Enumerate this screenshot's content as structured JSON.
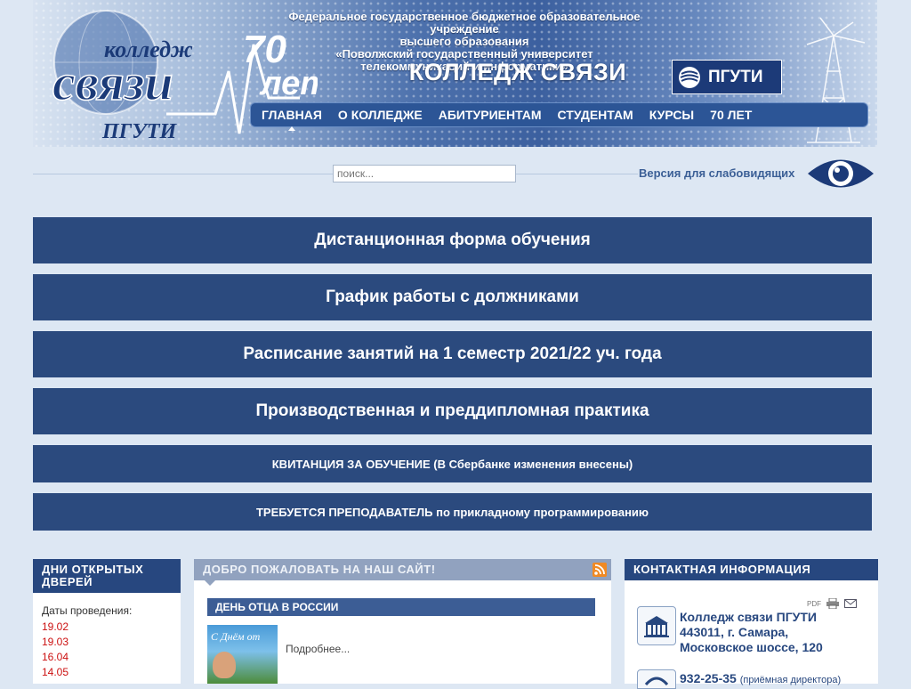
{
  "header": {
    "logo_text_top": "колледж",
    "logo_text_main": "связи",
    "logo_text_bottom": "ПГУТИ",
    "anniversary_number": "70",
    "anniversary_word": "лет",
    "institution_lines": [
      "Федеральное государственное бюджетное образовательное учреждение",
      "высшего образования",
      "«Поволжский государственный университет",
      "телекоммуникаций и информатики»"
    ],
    "title": "КОЛЛЕДЖ СВЯЗИ",
    "badge_label": "ПГУТИ"
  },
  "nav": {
    "items": [
      {
        "label": "ГЛАВНАЯ",
        "active": true
      },
      {
        "label": "О КОЛЛЕДЖЕ"
      },
      {
        "label": "АБИТУРИЕНТАМ"
      },
      {
        "label": "СТУДЕНТАМ"
      },
      {
        "label": "КУРСЫ"
      },
      {
        "label": "70 ЛЕТ"
      }
    ]
  },
  "search": {
    "placeholder": "поиск..."
  },
  "accessibility": {
    "label": "Версия для слабовидящих",
    "icon": "eye-icon"
  },
  "bands": [
    {
      "label": "Дистанционная форма обучения"
    },
    {
      "label": "График работы с должниками"
    },
    {
      "label": "Расписание занятий на 1 семестр 2021/22 уч. года"
    },
    {
      "label": "Производственная и преддипломная практика"
    },
    {
      "label": "КВИТАНЦИЯ ЗА ОБУЧЕНИЕ (В Сбербанке изменения внесены)"
    },
    {
      "label": "ТРЕБУЕТСЯ ПРЕПОДАВАТЕЛЬ по прикладному программированию"
    }
  ],
  "open_days": {
    "title": "ДНИ ОТКРЫТЫХ ДВЕРЕЙ",
    "subtitle": "Даты проведения:",
    "dates": [
      "19.02",
      "19.03",
      "16.04",
      "14.05"
    ]
  },
  "welcome": {
    "title": "ДОБРО ПОЖАЛОВАТЬ НА НАШ САЙТ!",
    "rss_icon": "rss-icon",
    "news_title": "ДЕНЬ ОТЦА В РОССИИ",
    "news_image_caption": "С Днём от",
    "more_link": "Подробнее..."
  },
  "contacts": {
    "title": "КОНТАКТНАЯ ИНФОРМАЦИЯ",
    "pdf_label": "PDF",
    "org_lines": [
      "Колледж связи ПГУТИ",
      "443011, г. Самара,",
      "Московское шоссе, 120"
    ],
    "phone": "932-25-35",
    "phone_note": "(приёмная директора)"
  },
  "colors": {
    "accent": "#27477f",
    "band": "#2b4a7e",
    "page_bg": "#dde7f3",
    "date_red": "#cc1111"
  }
}
